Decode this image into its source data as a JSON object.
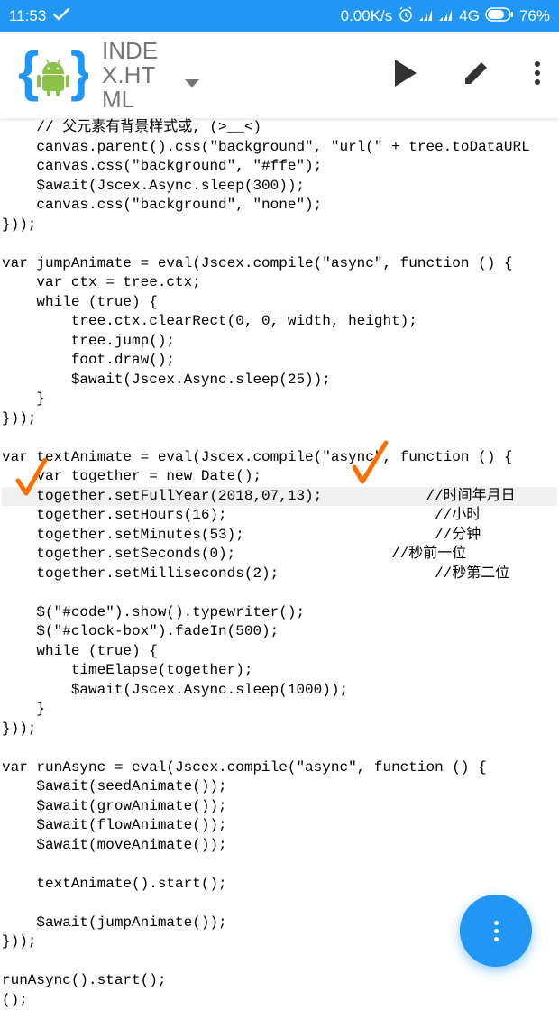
{
  "status": {
    "time": "11:53",
    "speed": "0.00K/s",
    "network": "4G",
    "battery": "76%"
  },
  "appbar": {
    "filename": "INDEX.HTML"
  },
  "code": {
    "lines": [
      "    // 父元素有背景样式或, (>__<)",
      "    canvas.parent().css(\"background\", \"url(\" + tree.toDataURL",
      "    canvas.css(\"background\", \"#ffe\");",
      "    $await(Jscex.Async.sleep(300));",
      "    canvas.css(\"background\", \"none\");",
      "}));",
      "",
      "var jumpAnimate = eval(Jscex.compile(\"async\", function () {",
      "    var ctx = tree.ctx;",
      "    while (true) {",
      "        tree.ctx.clearRect(0, 0, width, height);",
      "        tree.jump();",
      "        foot.draw();",
      "        $await(Jscex.Async.sleep(25));",
      "    }",
      "}));",
      "",
      "var textAnimate = eval(Jscex.compile(\"async\", function () {",
      "    var together = new Date();",
      "    together.setFullYear(2018,07,13);            //时间年月日",
      "    together.setHours(16);                        //小时",
      "    together.setMinutes(53);                      //分钟",
      "    together.setSeconds(0);                  //秒前一位",
      "    together.setMilliseconds(2);                  //秒第二位",
      "",
      "    $(\"#code\").show().typewriter();",
      "    $(\"#clock-box\").fadeIn(500);",
      "    while (true) {",
      "        timeElapse(together);",
      "        $await(Jscex.Async.sleep(1000));",
      "    }",
      "}));",
      "",
      "var runAsync = eval(Jscex.compile(\"async\", function () {",
      "    $await(seedAnimate());",
      "    $await(growAnimate());",
      "    $await(flowAnimate());",
      "    $await(moveAnimate());",
      "",
      "    textAnimate().start();",
      "",
      "    $await(jumpAnimate());",
      "}));",
      "",
      "runAsync().start();",
      "();"
    ],
    "highlightIndex": 19
  }
}
